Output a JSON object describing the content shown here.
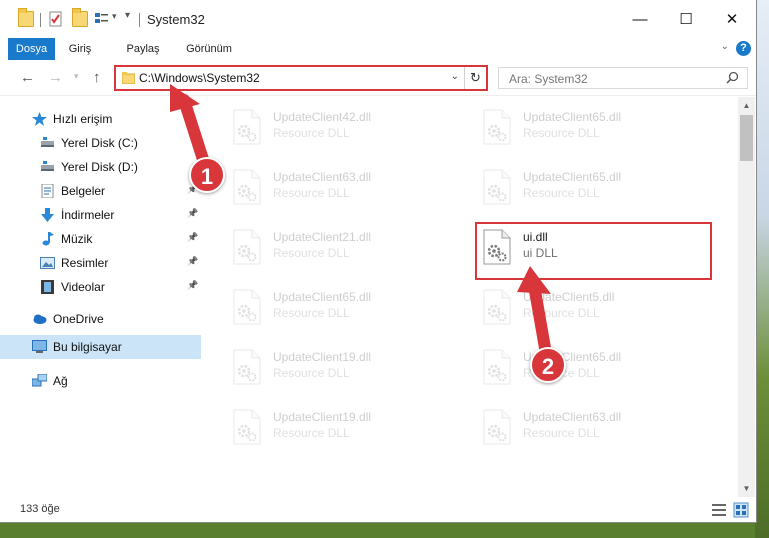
{
  "window": {
    "title": "System32",
    "controls": {
      "minimize": "—",
      "maximize": "☐",
      "close": "✕"
    }
  },
  "ribbon": {
    "tabs": [
      "Dosya",
      "Giriş",
      "Paylaş",
      "Görünüm"
    ],
    "active_tab": "Dosya",
    "help": "?"
  },
  "navigation": {
    "address": "C:\\Windows\\System32",
    "search_placeholder": "Ara: System32"
  },
  "sidebar": {
    "items": [
      {
        "label": "Hızlı erişim",
        "icon": "star-icon",
        "pinned": false
      },
      {
        "label": "Yerel Disk (C:)",
        "icon": "drive-icon",
        "pinned": false
      },
      {
        "label": "Yerel Disk (D:)",
        "icon": "drive-icon",
        "pinned": false
      },
      {
        "label": "Belgeler",
        "icon": "documents-icon",
        "pinned": true
      },
      {
        "label": "İndirmeler",
        "icon": "download-icon",
        "pinned": true
      },
      {
        "label": "Müzik",
        "icon": "music-icon",
        "pinned": true
      },
      {
        "label": "Resimler",
        "icon": "pictures-icon",
        "pinned": true
      },
      {
        "label": "Videolar",
        "icon": "video-icon",
        "pinned": true
      },
      {
        "label": "OneDrive",
        "icon": "cloud-icon",
        "pinned": false
      },
      {
        "label": "Bu bilgisayar",
        "icon": "computer-icon",
        "pinned": false,
        "selected": true
      },
      {
        "label": "Ağ",
        "icon": "network-icon",
        "pinned": false
      }
    ]
  },
  "files": {
    "left_column": [
      {
        "name": "UpdateClient42.dll",
        "type": "Resource DLL"
      },
      {
        "name": "UpdateClient63.dll",
        "type": "Resource DLL"
      },
      {
        "name": "UpdateClient21.dll",
        "type": "Resource DLL"
      },
      {
        "name": "UpdateClient65.dll",
        "type": "Resource DLL"
      },
      {
        "name": "UpdateClient19.dll",
        "type": "Resource DLL"
      },
      {
        "name": "UpdateClient19.dll",
        "type": "Resource DLL"
      }
    ],
    "right_column": [
      {
        "name": "UpdateClient65.dll",
        "type": "Resource DLL"
      },
      {
        "name": "UpdateClient65.dll",
        "type": "Resource DLL"
      },
      {
        "name": "ui.dll",
        "type": "ui DLL",
        "highlighted": true
      },
      {
        "name": "UpdateClient5.dll",
        "type": "Resource DLL"
      },
      {
        "name": "UpdateClient65.dll",
        "type": "Resource DLL"
      },
      {
        "name": "UpdateClient63.dll",
        "type": "Resource DLL"
      }
    ]
  },
  "status": {
    "item_count": "133 öğe"
  },
  "annotations": {
    "step1": "1",
    "step2": "2"
  },
  "colors": {
    "accent": "#1979ca",
    "highlight": "#d8363b",
    "selected": "#cce4f7"
  }
}
